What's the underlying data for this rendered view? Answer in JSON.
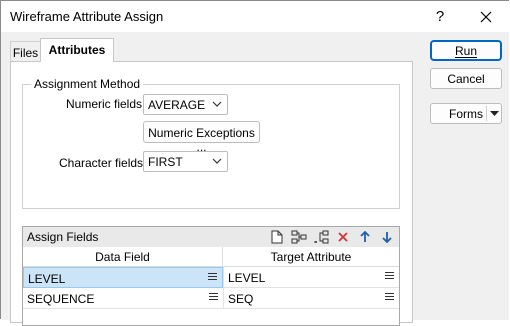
{
  "window": {
    "title": "Wireframe Attribute Assign",
    "help_glyph": "?",
    "close_glyph": "✕"
  },
  "tabs": [
    {
      "label": "Files"
    },
    {
      "label": "Attributes"
    }
  ],
  "assignment": {
    "legend": "Assignment Method",
    "numeric_label": "Numeric fields",
    "numeric_value": "AVERAGE",
    "exceptions_button": "Numeric Exceptions ...",
    "character_label": "Character fields",
    "character_value": "FIRST"
  },
  "assign_fields": {
    "title": "Assign Fields",
    "columns": [
      "Data Field",
      "Target Attribute"
    ],
    "rows": [
      {
        "data_field": "LEVEL",
        "target": "LEVEL"
      },
      {
        "data_field": "SEQUENCE",
        "target": "SEQ"
      }
    ]
  },
  "buttons": {
    "run": "Run",
    "cancel": "Cancel",
    "forms": "Forms"
  },
  "colors": {
    "accent": "#0067c0",
    "selected_row": "#cce4f7",
    "delete_icon": "#d13438",
    "arrow_icon": "#1f5fa8"
  }
}
